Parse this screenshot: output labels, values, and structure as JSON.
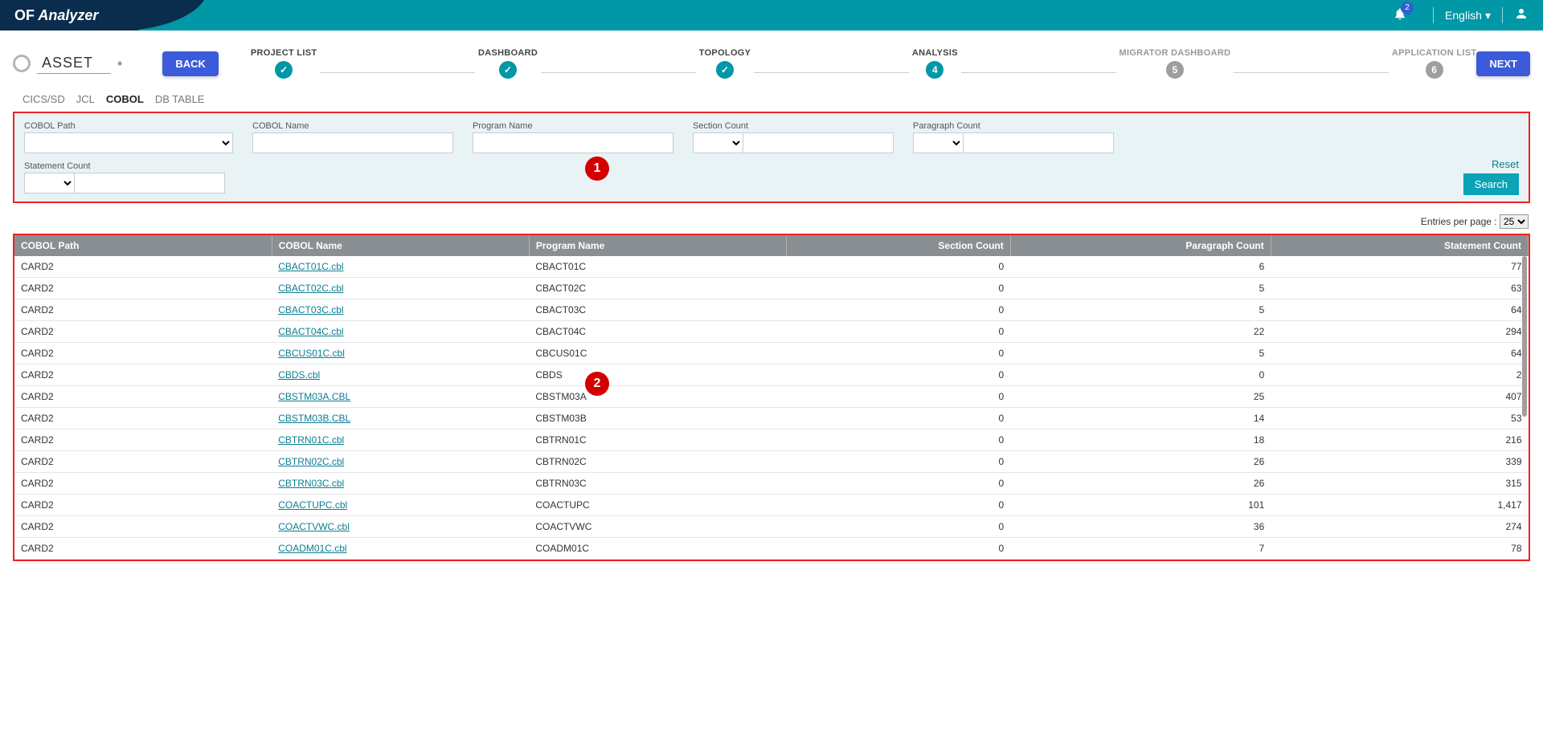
{
  "brand": {
    "of": "OF",
    "analyzer": "Analyzer"
  },
  "header": {
    "notif_count": "2",
    "language": "English"
  },
  "stepper": {
    "asset_label": "ASSET",
    "back": "BACK",
    "next": "NEXT",
    "steps": [
      {
        "label": "PROJECT LIST",
        "state": "done",
        "mark": "✓"
      },
      {
        "label": "DASHBOARD",
        "state": "done",
        "mark": "✓"
      },
      {
        "label": "TOPOLOGY",
        "state": "done",
        "mark": "✓"
      },
      {
        "label": "ANALYSIS",
        "state": "current",
        "mark": "4"
      },
      {
        "label": "MIGRATOR DASHBOARD",
        "state": "pending",
        "mark": "5"
      },
      {
        "label": "APPLICATION LIST",
        "state": "pending",
        "mark": "6"
      }
    ]
  },
  "subtabs": [
    "CICS/SD",
    "JCL",
    "COBOL",
    "DB TABLE"
  ],
  "subtab_active": "COBOL",
  "filter": {
    "cobol_path": "COBOL Path",
    "cobol_name": "COBOL Name",
    "program_name": "Program Name",
    "section_count": "Section Count",
    "paragraph_count": "Paragraph Count",
    "statement_count": "Statement Count",
    "reset": "Reset",
    "search": "Search"
  },
  "callouts": {
    "one": "1",
    "two": "2"
  },
  "epp": {
    "label": "Entries per page :",
    "value": "25"
  },
  "table": {
    "headers": [
      "COBOL Path",
      "COBOL Name",
      "Program Name",
      "Section Count",
      "Paragraph Count",
      "Statement Count"
    ],
    "rows": [
      {
        "path": "CARD2",
        "name": "CBACT01C.cbl",
        "prog": "CBACT01C",
        "sec": "0",
        "par": "6",
        "stmt": "77"
      },
      {
        "path": "CARD2",
        "name": "CBACT02C.cbl",
        "prog": "CBACT02C",
        "sec": "0",
        "par": "5",
        "stmt": "63"
      },
      {
        "path": "CARD2",
        "name": "CBACT03C.cbl",
        "prog": "CBACT03C",
        "sec": "0",
        "par": "5",
        "stmt": "64"
      },
      {
        "path": "CARD2",
        "name": "CBACT04C.cbl",
        "prog": "CBACT04C",
        "sec": "0",
        "par": "22",
        "stmt": "294"
      },
      {
        "path": "CARD2",
        "name": "CBCUS01C.cbl",
        "prog": "CBCUS01C",
        "sec": "0",
        "par": "5",
        "stmt": "64"
      },
      {
        "path": "CARD2",
        "name": "CBDS.cbl",
        "prog": "CBDS",
        "sec": "0",
        "par": "0",
        "stmt": "2"
      },
      {
        "path": "CARD2",
        "name": "CBSTM03A.CBL",
        "prog": "CBSTM03A",
        "sec": "0",
        "par": "25",
        "stmt": "407"
      },
      {
        "path": "CARD2",
        "name": "CBSTM03B.CBL",
        "prog": "CBSTM03B",
        "sec": "0",
        "par": "14",
        "stmt": "53"
      },
      {
        "path": "CARD2",
        "name": "CBTRN01C.cbl",
        "prog": "CBTRN01C",
        "sec": "0",
        "par": "18",
        "stmt": "216"
      },
      {
        "path": "CARD2",
        "name": "CBTRN02C.cbl",
        "prog": "CBTRN02C",
        "sec": "0",
        "par": "26",
        "stmt": "339"
      },
      {
        "path": "CARD2",
        "name": "CBTRN03C.cbl",
        "prog": "CBTRN03C",
        "sec": "0",
        "par": "26",
        "stmt": "315"
      },
      {
        "path": "CARD2",
        "name": "COACTUPC.cbl",
        "prog": "COACTUPC",
        "sec": "0",
        "par": "101",
        "stmt": "1,417"
      },
      {
        "path": "CARD2",
        "name": "COACTVWC.cbl",
        "prog": "COACTVWC",
        "sec": "0",
        "par": "36",
        "stmt": "274"
      },
      {
        "path": "CARD2",
        "name": "COADM01C.cbl",
        "prog": "COADM01C",
        "sec": "0",
        "par": "7",
        "stmt": "78"
      }
    ]
  }
}
